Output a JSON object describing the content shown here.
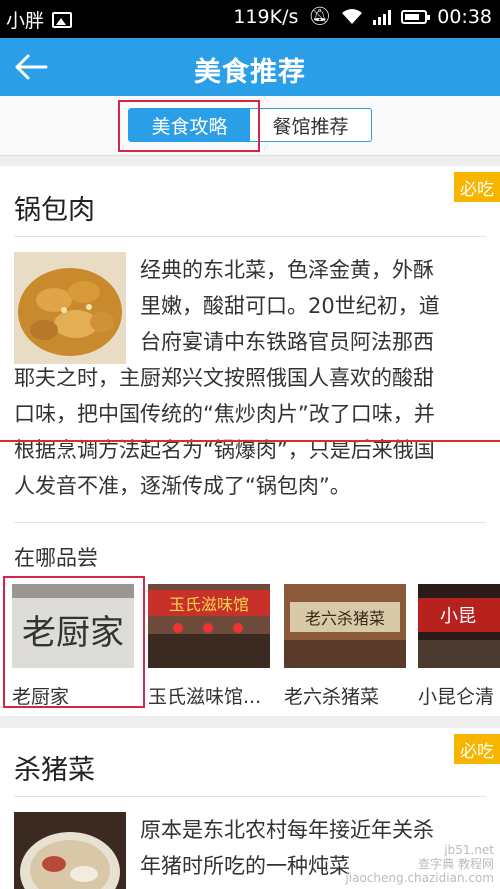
{
  "status_bar": {
    "carrier": "小胖",
    "net_speed": "119K/s",
    "time": "00:38",
    "icons": [
      "image-icon",
      "mute-icon",
      "wifi-icon",
      "signal-icon",
      "battery-icon"
    ]
  },
  "header": {
    "title": "美食推荐",
    "back_icon": "arrow-left-icon"
  },
  "tabs": [
    {
      "label": "美食攻略",
      "active": true
    },
    {
      "label": "餐馆推荐",
      "active": false
    }
  ],
  "dishes": [
    {
      "badge": "必吃",
      "name": "锅包肉",
      "description_lines": [
        "经典的东北菜，色泽金黄，外酥",
        "里嫩，酸甜可口。20世纪初，道",
        "台府宴请中东铁路官员阿法那西",
        "耶夫之时，主厨郑兴文按照俄国人喜欢的酸甜",
        "口味，把中国传统的“焦炒肉片”改了口味，并",
        "根据烹调方法起名为“锅爆肉”，只是后来俄国",
        "人发音不准，逐渐传成了“锅包肉”。"
      ],
      "where_title": "在哪品尝",
      "places": [
        {
          "name": "老厨家",
          "sign": "老厨家"
        },
        {
          "name": "玉氏滋味馆...",
          "sign": "玉氏滋味馆"
        },
        {
          "name": "老六杀猪菜",
          "sign": "老六杀猪菜"
        },
        {
          "name": "小昆仑清",
          "sign": "小昆"
        }
      ]
    },
    {
      "badge": "必吃",
      "name": "杀猪菜",
      "description_lines": [
        "原本是东北农村每年接近年关杀",
        "年猪时所吃的一种炖菜"
      ]
    }
  ],
  "watermark": {
    "line1": "jb51.net",
    "line2": "查字典 教程网",
    "line3": "jiaocheng.chazidian.com"
  },
  "colors": {
    "accent": "#2a9ee6",
    "badge": "#f7b500",
    "highlight": "#d4264a",
    "status_bar": "#000000"
  }
}
